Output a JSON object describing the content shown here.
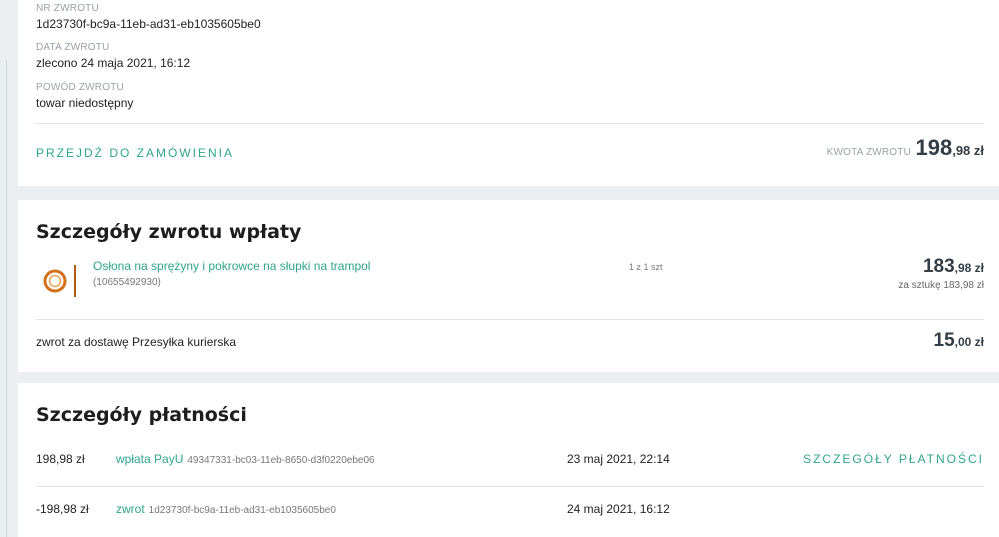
{
  "refund_info": {
    "nr_label": "NR ZWROTU",
    "nr_value": "1d23730f-bc9a-11eb-ad31-eb1035605be0",
    "date_label": "DATA ZWROTU",
    "date_value": "zlecono 24 maja 2021, 16:12",
    "reason_label": "POWÓD ZWROTU",
    "reason_value": "towar niedostępny",
    "goto_order_link": "PRZEJDŹ DO ZAMÓWIENIA",
    "amount_label": "KWOTA ZWROTU",
    "amount_int": "198",
    "amount_dec": ",98 zł"
  },
  "refund_details": {
    "title": "Szczegóły zwrotu wpłaty",
    "product": {
      "name": "Osłona na sprężyny i pokrowce na słupki na trampol",
      "id": "(10655492930)",
      "qty": "1 z 1 szt",
      "price_int": "183",
      "price_dec": ",98 zł",
      "unit_price": "za sztukę 183,98 zł"
    },
    "shipping": {
      "label": "zwrot za dostawę Przesyłka kurierska",
      "amount_int": "15",
      "amount_dec": ",00 zł"
    }
  },
  "payment_details": {
    "title": "Szczegóły płatności",
    "payments_link": "SZCZEGÓŁY PŁATNOŚCI",
    "rows": [
      {
        "amount": "198,98 zł",
        "method": "wpłata PayU",
        "ref": "49347331-bc03-11eb-8650-d3f0220ebe06",
        "date": "23 maj 2021, 22:14"
      },
      {
        "amount": "-198,98 zł",
        "method": "zwrot",
        "ref": "1d23730f-bc9a-11eb-ad31-eb1035605be0",
        "date": "24 maj 2021, 16:12"
      }
    ]
  },
  "colors": {
    "accent": "#2fa58a",
    "background": "#eceff1",
    "amount": "#333d45",
    "product_icon": "#d4701a"
  }
}
